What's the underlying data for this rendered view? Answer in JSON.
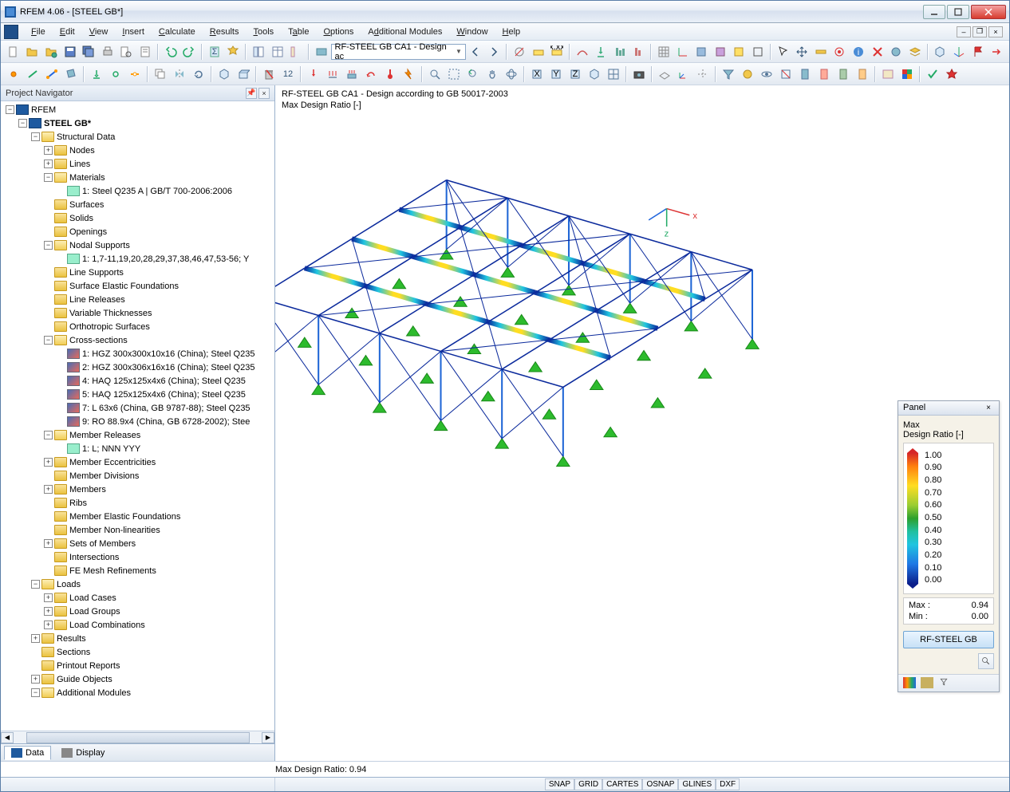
{
  "window": {
    "title": "RFEM 4.06 - [STEEL GB*]"
  },
  "menu": {
    "items": [
      "File",
      "Edit",
      "View",
      "Insert",
      "Calculate",
      "Results",
      "Tools",
      "Table",
      "Options",
      "Additional Modules",
      "Window",
      "Help"
    ]
  },
  "combo": {
    "value": "RF-STEEL GB CA1 - Design ac"
  },
  "navigator": {
    "title": "Project Navigator",
    "root": "RFEM",
    "project": "STEEL GB*",
    "tabs": {
      "data": "Data",
      "display": "Display"
    }
  },
  "tree": {
    "structural": "Structural Data",
    "nodes": "Nodes",
    "lines": "Lines",
    "materials": "Materials",
    "mat1": "1: Steel Q235 A | GB/T 700-2006:2006",
    "surfaces": "Surfaces",
    "solids": "Solids",
    "openings": "Openings",
    "nodal_supports": "Nodal Supports",
    "ns1": "1: 1,7-11,19,20,28,29,37,38,46,47,53-56; Y",
    "line_supports": "Line Supports",
    "sef": "Surface Elastic Foundations",
    "line_releases": "Line Releases",
    "var_thick": "Variable Thicknesses",
    "ortho": "Orthotropic Surfaces",
    "cross": "Cross-sections",
    "cs1": "1: HGZ 300x300x10x16 (China); Steel Q235",
    "cs2": "2: HGZ 300x306x16x16 (China); Steel Q235",
    "cs4": "4: HAQ 125x125x4x6 (China); Steel Q235",
    "cs5": "5: HAQ 125x125x4x6 (China); Steel Q235",
    "cs7": "7: L 63x6 (China, GB 9787-88); Steel Q235",
    "cs9": "9: RO 88.9x4 (China, GB 6728-2002); Stee",
    "mem_rel": "Member Releases",
    "mr1": "1: L; NNN YYY",
    "mem_ecc": "Member Eccentricities",
    "mem_div": "Member Divisions",
    "members": "Members",
    "ribs": "Ribs",
    "mef": "Member Elastic Foundations",
    "mnl": "Member Non-linearities",
    "som": "Sets of Members",
    "intersections": "Intersections",
    "fe_mesh": "FE Mesh Refinements",
    "loads": "Loads",
    "lc": "Load Cases",
    "lg": "Load Groups",
    "lcomb": "Load Combinations",
    "results": "Results",
    "sections": "Sections",
    "printout": "Printout Reports",
    "guide": "Guide Objects",
    "addmod": "Additional Modules"
  },
  "viewport": {
    "line1": "RF-STEEL GB CA1 - Design according to GB 50017-2003",
    "line2": "Max Design Ratio [-]"
  },
  "panel": {
    "title": "Panel",
    "head1": "Max",
    "head2": "Design Ratio [-]",
    "scale": [
      "1.00",
      "0.90",
      "0.80",
      "0.70",
      "0.60",
      "0.50",
      "0.40",
      "0.30",
      "0.20",
      "0.10",
      "0.00"
    ],
    "max_lbl": "Max  :",
    "max_val": "0.94",
    "min_lbl": "Min   :",
    "min_val": "0.00",
    "button": "RF-STEEL GB"
  },
  "status": {
    "ratio": "Max Design Ratio: 0.94",
    "toggles": [
      "SNAP",
      "GRID",
      "CARTES",
      "OSNAP",
      "GLINES",
      "DXF"
    ]
  }
}
